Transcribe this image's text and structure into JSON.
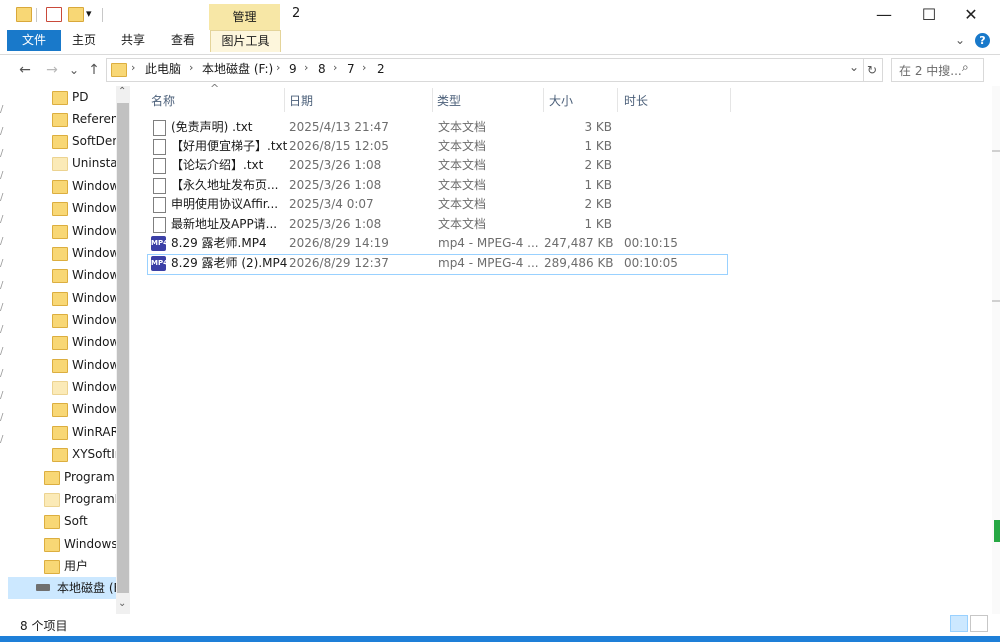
{
  "titlebar": {
    "manage_label": "管理",
    "window_title": "2",
    "minimize_glyph": "—",
    "maximize_glyph": "☐",
    "close_glyph": "✕",
    "dropdown_glyph": "▾"
  },
  "ribbon": {
    "tabs": [
      {
        "label": "文件"
      },
      {
        "label": "主页"
      },
      {
        "label": "共享"
      },
      {
        "label": "查看"
      },
      {
        "label": "图片工具"
      }
    ],
    "help_glyph": "?",
    "collapse_glyph": "⌄"
  },
  "address": {
    "back_glyph": "←",
    "forward_glyph": "→",
    "recent_glyph": "⌄",
    "up_glyph": "↑",
    "crumbs": [
      "此电脑",
      "本地磁盘 (F:)",
      "9",
      "8",
      "7",
      "2"
    ],
    "crumb_separator": "›",
    "dropdown_glyph": "⌄",
    "refresh_glyph": "↻",
    "search_placeholder": "在 2 中搜...",
    "search_glyph": "⌕"
  },
  "nav": {
    "items": [
      {
        "label": "PD",
        "pale": false
      },
      {
        "label": "Referen",
        "pale": false
      },
      {
        "label": "SoftDen",
        "pale": false
      },
      {
        "label": "Uninstal",
        "pale": true
      },
      {
        "label": "Window",
        "pale": false
      },
      {
        "label": "Window",
        "pale": false
      },
      {
        "label": "Window",
        "pale": false
      },
      {
        "label": "Window",
        "pale": false
      },
      {
        "label": "Window",
        "pale": false
      },
      {
        "label": "Window",
        "pale": false
      },
      {
        "label": "Window",
        "pale": false
      },
      {
        "label": "Window",
        "pale": false
      },
      {
        "label": "Window",
        "pale": false
      },
      {
        "label": "Window",
        "pale": true
      },
      {
        "label": "Window",
        "pale": false
      },
      {
        "label": "WinRAR",
        "pale": false
      },
      {
        "label": "XYSoftIr",
        "pale": false
      }
    ],
    "root_items": [
      {
        "label": "Program",
        "pale": false
      },
      {
        "label": "ProgramD",
        "pale": true
      },
      {
        "label": "Soft",
        "pale": false
      },
      {
        "label": "Windows",
        "pale": false
      },
      {
        "label": "用户",
        "pale": false
      }
    ],
    "drive_label": "本地磁盘 (F",
    "scroll_up_glyph": "⌃",
    "scroll_down_glyph": "⌄"
  },
  "columns": {
    "sort_glyph": "^",
    "name": "名称",
    "date": "日期",
    "type": "类型",
    "size": "大小",
    "duration": "时长"
  },
  "files": [
    {
      "name": "(免责声明) .txt",
      "date": "2025/4/13 21:47",
      "type": "文本文档",
      "size": "3 KB",
      "duration": "",
      "icon": "text-file-icon"
    },
    {
      "name": "【好用便宜梯子】.txt",
      "date": "2026/8/15 12:05",
      "type": "文本文档",
      "size": "1 KB",
      "duration": "",
      "icon": "text-file-icon"
    },
    {
      "name": "【论坛介绍】.txt",
      "date": "2025/3/26 1:08",
      "type": "文本文档",
      "size": "2 KB",
      "duration": "",
      "icon": "text-file-icon"
    },
    {
      "name": "【永久地址发布页...",
      "date": "2025/3/26 1:08",
      "type": "文本文档",
      "size": "1 KB",
      "duration": "",
      "icon": "text-file-icon"
    },
    {
      "name": "申明使用协议Affir...",
      "date": "2025/3/4 0:07",
      "type": "文本文档",
      "size": "2 KB",
      "duration": "",
      "icon": "text-file-icon"
    },
    {
      "name": "最新地址及APP请...",
      "date": "2025/3/26 1:08",
      "type": "文本文档",
      "size": "1 KB",
      "duration": "",
      "icon": "text-file-icon"
    },
    {
      "name": "8.29 露老师.MP4",
      "date": "2026/8/29 14:19",
      "type": "mp4 - MPEG-4 ...",
      "size": "247,487 KB",
      "duration": "00:10:15",
      "icon": "mp4-file-icon"
    },
    {
      "name": "8.29 露老师 (2).MP4",
      "date": "2026/8/29 12:37",
      "type": "mp4 - MPEG-4 ...",
      "size": "289,486 KB",
      "duration": "00:10:05",
      "icon": "mp4-file-icon"
    }
  ],
  "mp4_badge": "MP4",
  "status": {
    "count_text": "8 个项目"
  },
  "colors": {
    "accent": "#1979ca",
    "manage_tab": "#f7e7a6",
    "selection_border": "#99d1ff",
    "folder": "#f8d775"
  }
}
